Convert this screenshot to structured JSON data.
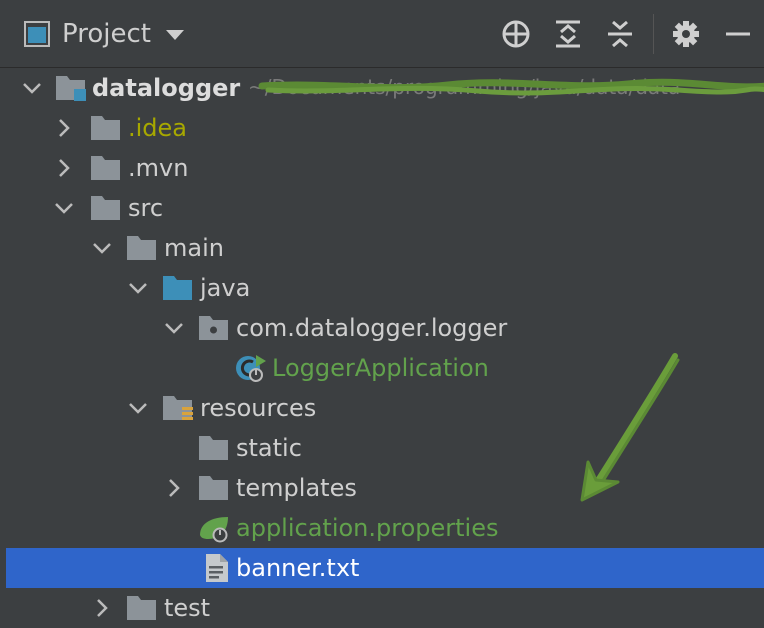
{
  "toolbar": {
    "title": "Project",
    "icons": [
      "target-icon",
      "expand-all-icon",
      "collapse-all-icon",
      "gear-icon",
      "minimize-icon"
    ]
  },
  "tree": {
    "root": {
      "label": "datalogger",
      "path_text": "~/Documents/programming/java/data/data"
    },
    "items": [
      {
        "label": ".idea"
      },
      {
        "label": ".mvn"
      },
      {
        "label": "src"
      },
      {
        "label": "main"
      },
      {
        "label": "java"
      },
      {
        "label": "com.datalogger.logger"
      },
      {
        "label": "LoggerApplication"
      },
      {
        "label": "resources"
      },
      {
        "label": "static"
      },
      {
        "label": "templates"
      },
      {
        "label": "application.properties"
      },
      {
        "label": "banner.txt"
      },
      {
        "label": "test"
      }
    ]
  },
  "colors": {
    "background": "#3c3f41",
    "selection": "#2f65ca",
    "spring_green": "#62a24c",
    "idea_yellow": "#a7a800",
    "folder_gray": "#8c9399",
    "source_blue": "#3d8fb8"
  }
}
